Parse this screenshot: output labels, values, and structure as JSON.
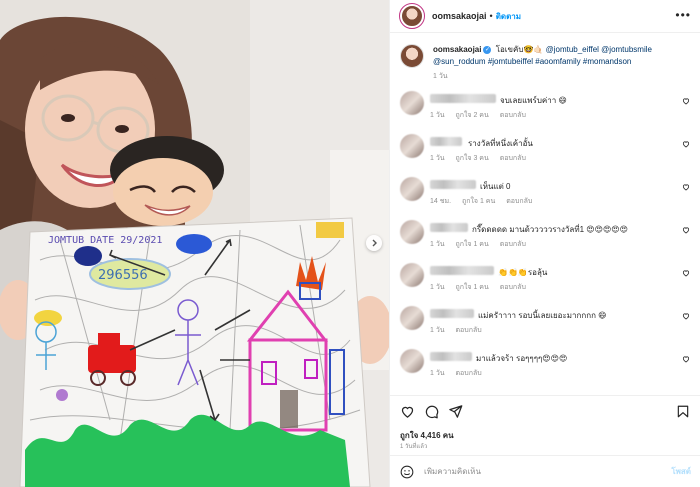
{
  "post": {
    "username": "oomsakaojai",
    "follow_label": "ติดตาม",
    "more_icon": "more-horizontal-icon"
  },
  "caption": {
    "username": "oomsakaojai",
    "text": "โอเขคับ🤓🤙🏻",
    "tags": [
      "@jomtub_eiffel",
      "@jomtubsmile",
      "@sun_roddum",
      "#jomtubeiffel",
      "#aoomfamily",
      "#momandson"
    ],
    "time": "1 วัน"
  },
  "comments": [
    {
      "text": "จบเลยแพร์บค่าา 😄",
      "time": "1 วัน",
      "likes": "ถูกใจ 2 คน",
      "reply": "ตอบกลับ"
    },
    {
      "text": "รางวัลที่หนึ่งเค้าอั้น",
      "time": "1 วัน",
      "likes": "ถูกใจ 3 คน",
      "reply": "ตอบกลับ"
    },
    {
      "text": "เห็นแต่ 0",
      "time": "14 ชม.",
      "likes": "ถูกใจ 1 คน",
      "reply": "ตอบกลับ"
    },
    {
      "text": "กรี๊ดดดดด มานด้วววววรางวัลที่1 😍😍😍😍😍",
      "time": "1 วัน",
      "likes": "ถูกใจ 1 คน",
      "reply": "ตอบกลับ"
    },
    {
      "text": "👏👏👏รอลุ้น",
      "time": "1 วัน",
      "likes": "ถูกใจ 1 คน",
      "reply": "ตอบกลับ"
    },
    {
      "text": "แม่ครัาาาา รอบนี้เลยเยอะมากกกก 😄",
      "time": "1 วัน",
      "likes": "",
      "reply": "ตอบกลับ"
    },
    {
      "text": "มาแล้วจร้า รอๆๆๆๆ😍😍😍",
      "time": "1 วัน",
      "likes": "",
      "reply": "ตอบกลับ"
    }
  ],
  "actions": {
    "like_icon": "heart-icon",
    "comment_icon": "comment-icon",
    "share_icon": "send-icon",
    "save_icon": "bookmark-icon"
  },
  "likes_label": "ถูกใจ 4,416 คน",
  "post_time": "1 วันที่แล้ว",
  "add_comment": {
    "placeholder": "เพิ่มความคิดเห็น",
    "post_label": "โพสต์",
    "emoji_icon": "emoji-smile-icon"
  },
  "drawing": {
    "date_text": "JOMTUB  DATE 29/2021",
    "number_text": "296556"
  },
  "colors": {
    "link": "#00376b",
    "accent": "#0095f6",
    "muted": "#8e8e8e",
    "verified": "#3897f0"
  }
}
